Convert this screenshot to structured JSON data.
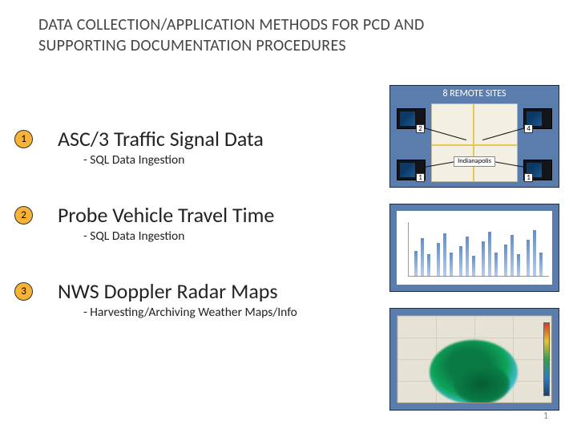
{
  "title": "DATA COLLECTION/APPLICATION METHODS FOR  PCD AND SUPPORTING DOCUMENTATION PROCEDURES",
  "items": [
    {
      "num": "1",
      "head": "ASC/3 Traffic Signal Data",
      "sub": "- SQL Data Ingestion"
    },
    {
      "num": "2",
      "head": "Probe Vehicle Travel Time",
      "sub": "- SQL Data Ingestion"
    },
    {
      "num": "3",
      "head": "NWS Doppler Radar Maps",
      "sub": "- Harvesting/Archiving Weather Maps/Info"
    }
  ],
  "panel1": {
    "title": "8 REMOTE SITES",
    "city": "Indianapolis",
    "devices": [
      "2",
      "4",
      "1",
      "1"
    ]
  },
  "page_number": "1"
}
